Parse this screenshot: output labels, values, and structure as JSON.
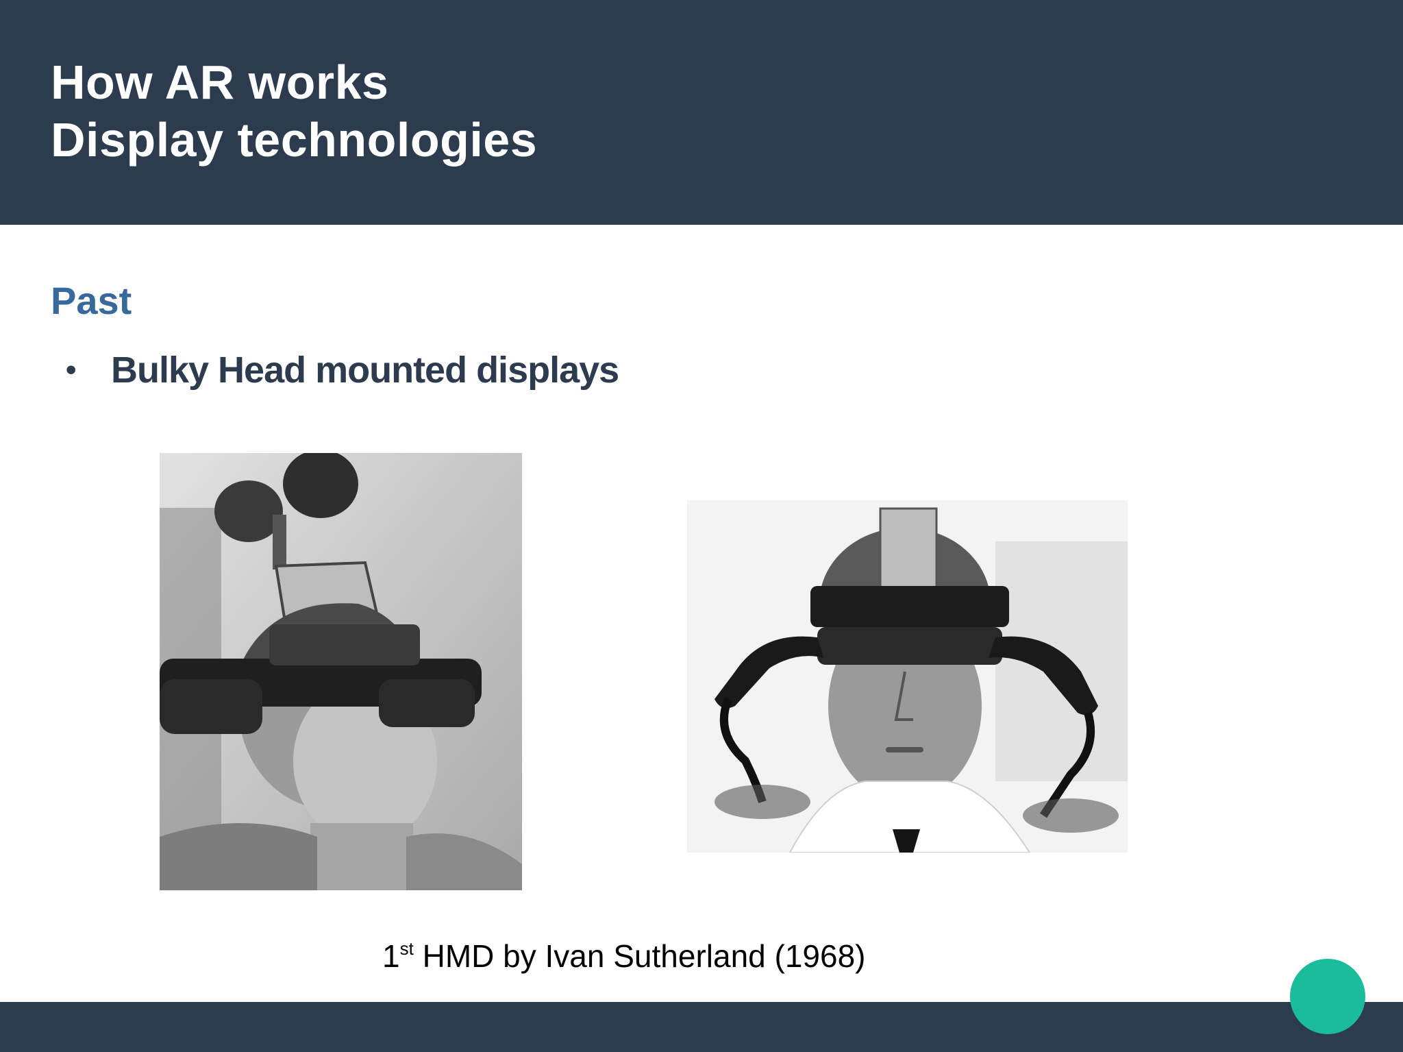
{
  "header": {
    "title_line1": "How AR works",
    "title_line2": "Display technologies",
    "background_color": "#2c3b4e"
  },
  "content": {
    "section_heading": "Past",
    "bullets": [
      {
        "marker": "•",
        "text": "Bulky Head mounted displays"
      }
    ],
    "images": [
      {
        "name": "man-wearing-hmd-side-view"
      },
      {
        "name": "man-wearing-hmd-front-view"
      }
    ],
    "caption": {
      "ordinal_number": "1",
      "ordinal_suffix": "st",
      "text": " HMD by Ivan Sutherland (1968)"
    }
  },
  "colors": {
    "heading_blue": "#37699a",
    "bullet_text": "#2c3b4e",
    "accent_circle": "#1bbc9b",
    "footer": "#2c3b4e"
  }
}
